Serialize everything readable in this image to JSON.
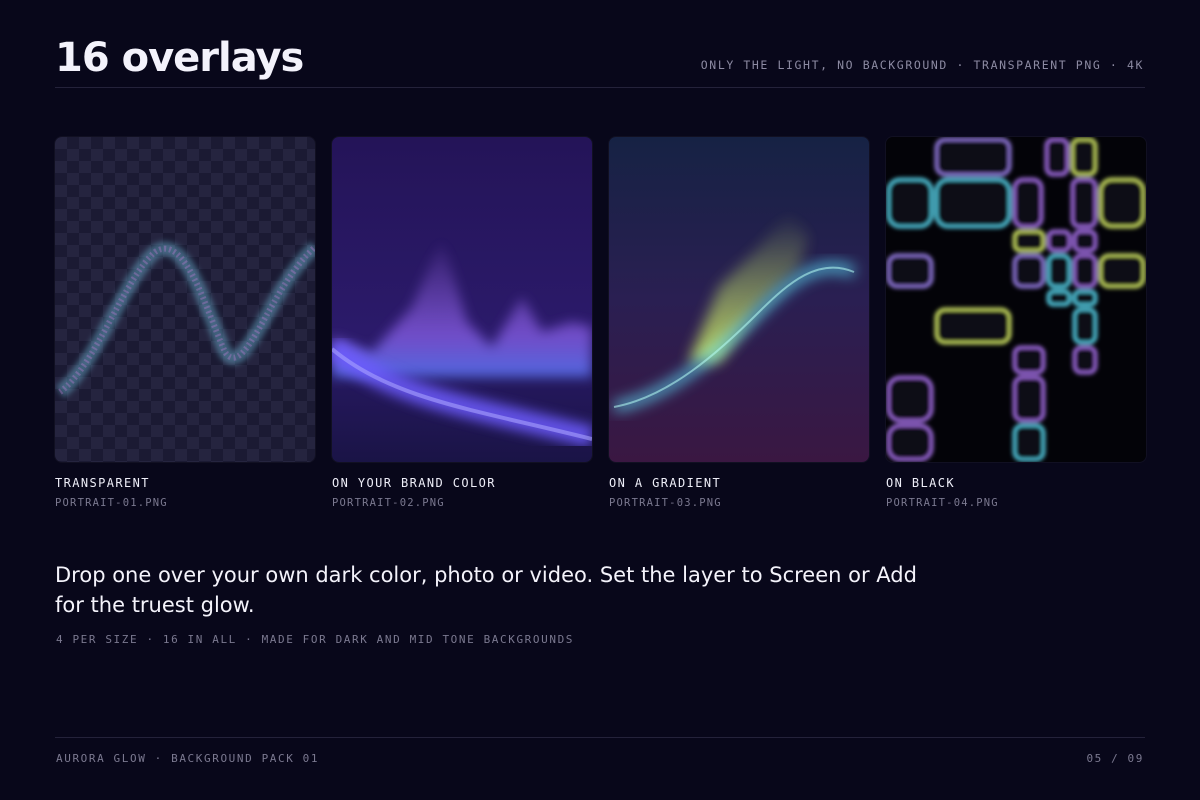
{
  "header": {
    "title": "16 overlays",
    "subtitle": "ONLY THE LIGHT, NO BACKGROUND · TRANSPARENT PNG · 4K"
  },
  "cards": [
    {
      "label": "TRANSPARENT",
      "file": "PORTRAIT-01.PNG"
    },
    {
      "label": "ON YOUR BRAND COLOR",
      "file": "PORTRAIT-02.PNG"
    },
    {
      "label": "ON A GRADIENT",
      "file": "PORTRAIT-03.PNG"
    },
    {
      "label": "ON BLACK",
      "file": "PORTRAIT-04.PNG"
    }
  ],
  "body": {
    "headline": "Drop one over your own dark color, photo or video. Set the layer to Screen or Add for the truest glow.",
    "meta": "4 PER SIZE · 16 IN ALL · MADE FOR DARK AND MID TONE BACKGROUNDS"
  },
  "footer": {
    "left": "AURORA GLOW · BACKGROUND PACK 01",
    "right": "05 / 09"
  },
  "colors": {
    "background": "#08071a",
    "accent_violet": "#8a5cff",
    "accent_lime": "#d8ff6a",
    "accent_cyan": "#5fe6ff"
  }
}
